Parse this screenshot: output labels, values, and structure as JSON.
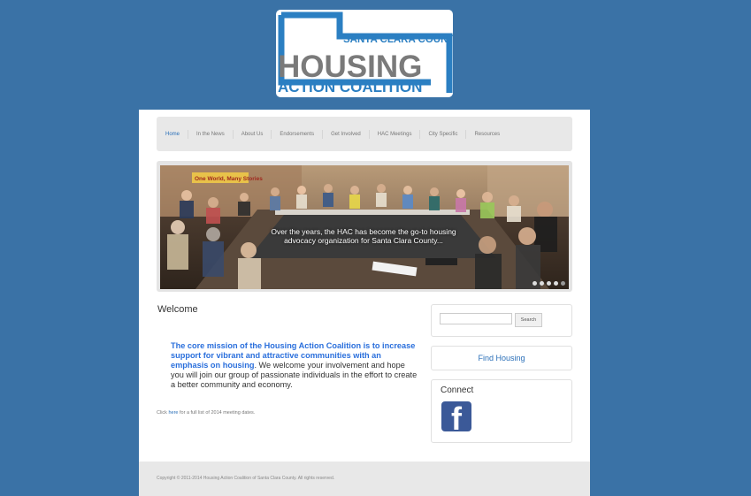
{
  "logo": {
    "line1": "SANTA CLARA COUNTY",
    "line2": "HOUSING",
    "line3": "ACTION COALITION"
  },
  "nav": {
    "items": [
      "Home",
      "In the News",
      "About Us",
      "Endorsements",
      "Get Involved",
      "HAC Meetings",
      "City Specific",
      "Resources"
    ]
  },
  "slider": {
    "caption": "Over the years, the HAC has become the go-to housing advocacy organization for Santa Clara County...",
    "banner_text": "One World, Many Stories",
    "slide_count": 5,
    "active_slide": 5
  },
  "main": {
    "welcome_title": "Welcome",
    "mission_bold": "The core mission of the Housing Action Coalition is to increase support for vibrant and attractive communities with an emphasis on housing",
    "mission_rest": ". We welcome your involvement and hope you will join our group of passionate individuals in the effort to create a better community and economy.",
    "meeting_prefix": "Click ",
    "meeting_link": "here",
    "meeting_suffix": " for a full list of 2014 meeting dates."
  },
  "sidebar": {
    "search_placeholder": "",
    "search_button": "Search",
    "find_housing": "Find Housing",
    "connect_title": "Connect",
    "facebook_letter": "f"
  },
  "footer": {
    "copyright": "Copyright © 2011-2014 Housing Action Coalition of Santa Clara County. All rights reserved."
  },
  "colors": {
    "background": "#3a72a6",
    "logo_blue": "#2b7fc2",
    "logo_gray": "#7a7a7a",
    "link": "#2a6fb8"
  }
}
